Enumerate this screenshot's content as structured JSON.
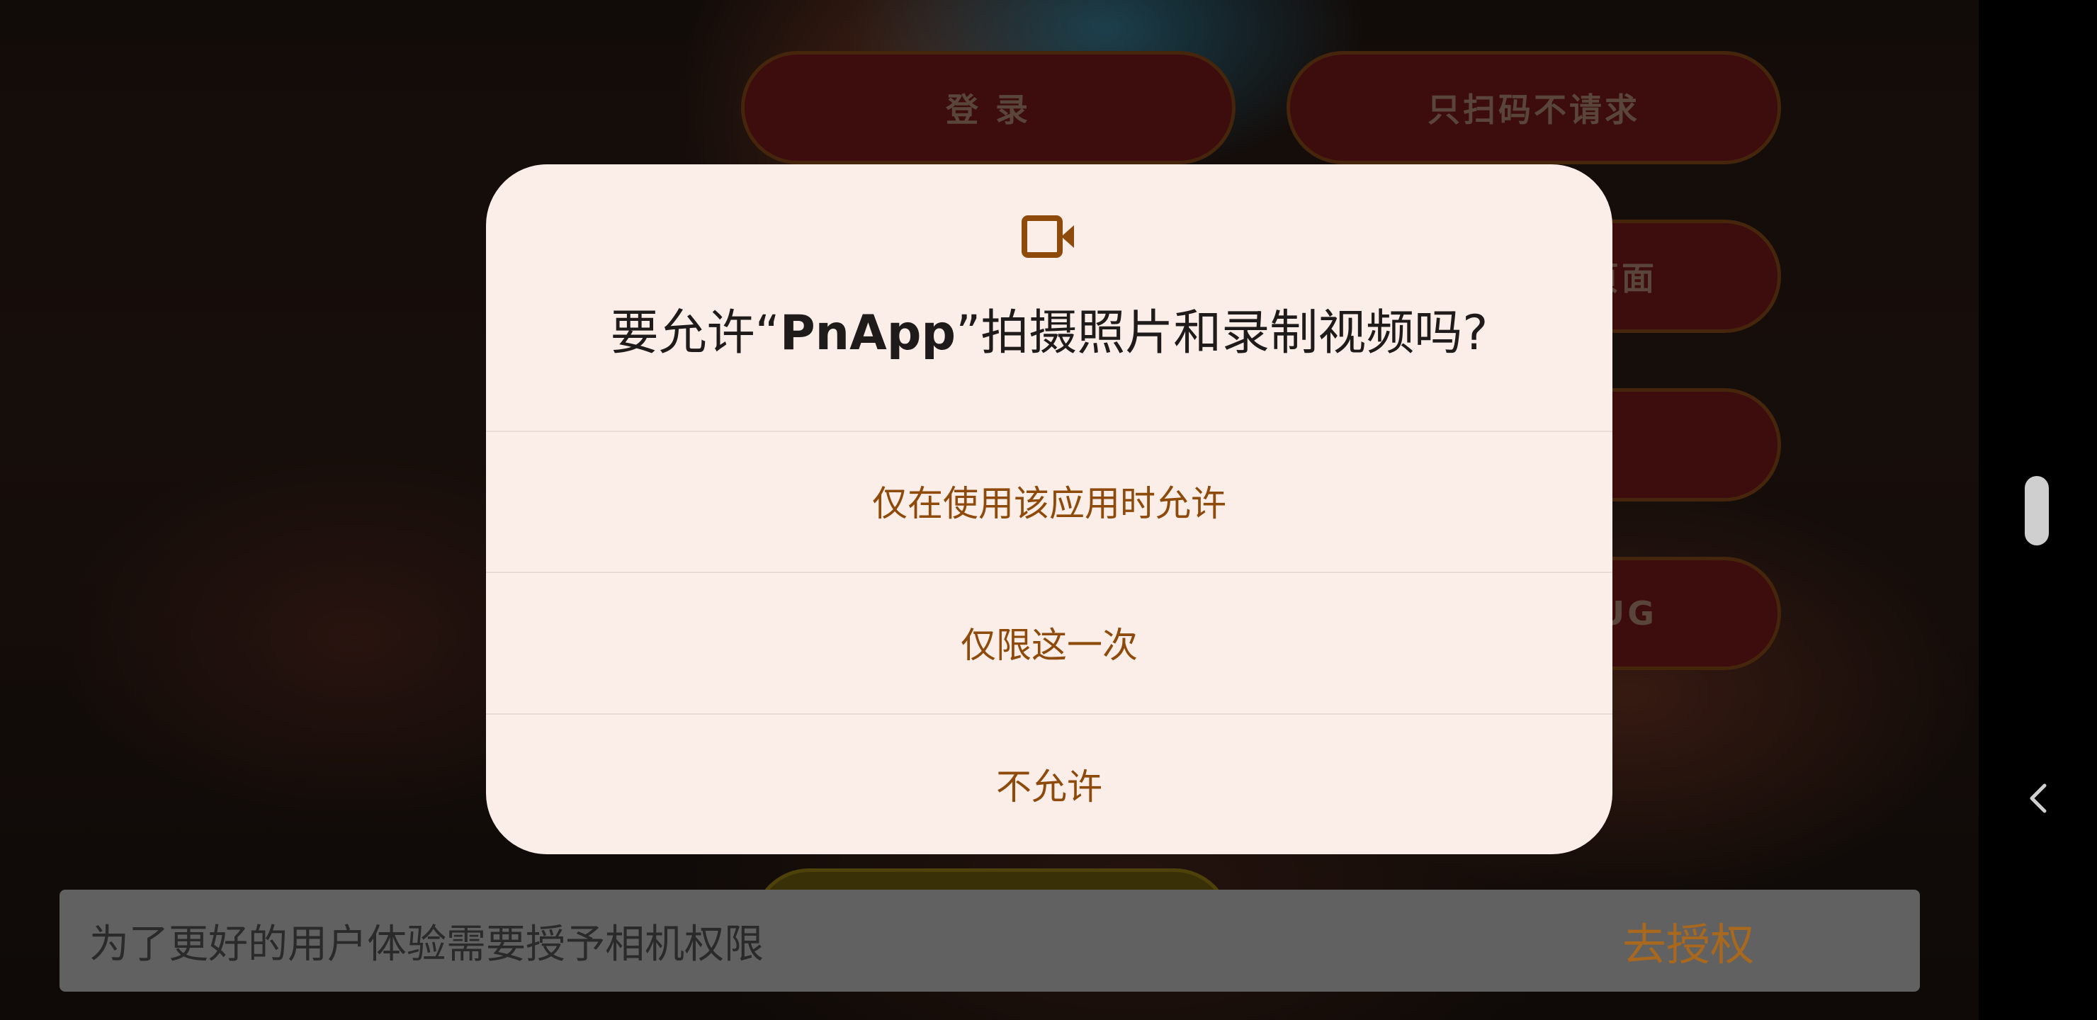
{
  "background_app": {
    "buttons": [
      {
        "label": "登 录"
      },
      {
        "label": "只扫码不请求"
      },
      {
        "label": "页面"
      },
      {
        "label": ""
      },
      {
        "label": "UG"
      }
    ]
  },
  "permission_dialog": {
    "icon": "video-camera-icon",
    "title_prefix": "要允许“",
    "app_name": "PnApp",
    "title_suffix": "”拍摄照片和录制视频吗?",
    "options": [
      {
        "label": "仅在使用该应用时允许"
      },
      {
        "label": "仅限这一次"
      },
      {
        "label": "不允许"
      }
    ]
  },
  "snackbar": {
    "message": "为了更好的用户体验需要授予相机权限",
    "action": "去授权"
  },
  "system_nav": {
    "back_icon": "chevron-left-icon",
    "handle_icon": "scroll-handle"
  },
  "colors": {
    "dialog_bg": "#fbeee8",
    "accent": "#8e4a0a",
    "snackbar_bg": "#616161",
    "snackbar_action": "#a8681e"
  }
}
